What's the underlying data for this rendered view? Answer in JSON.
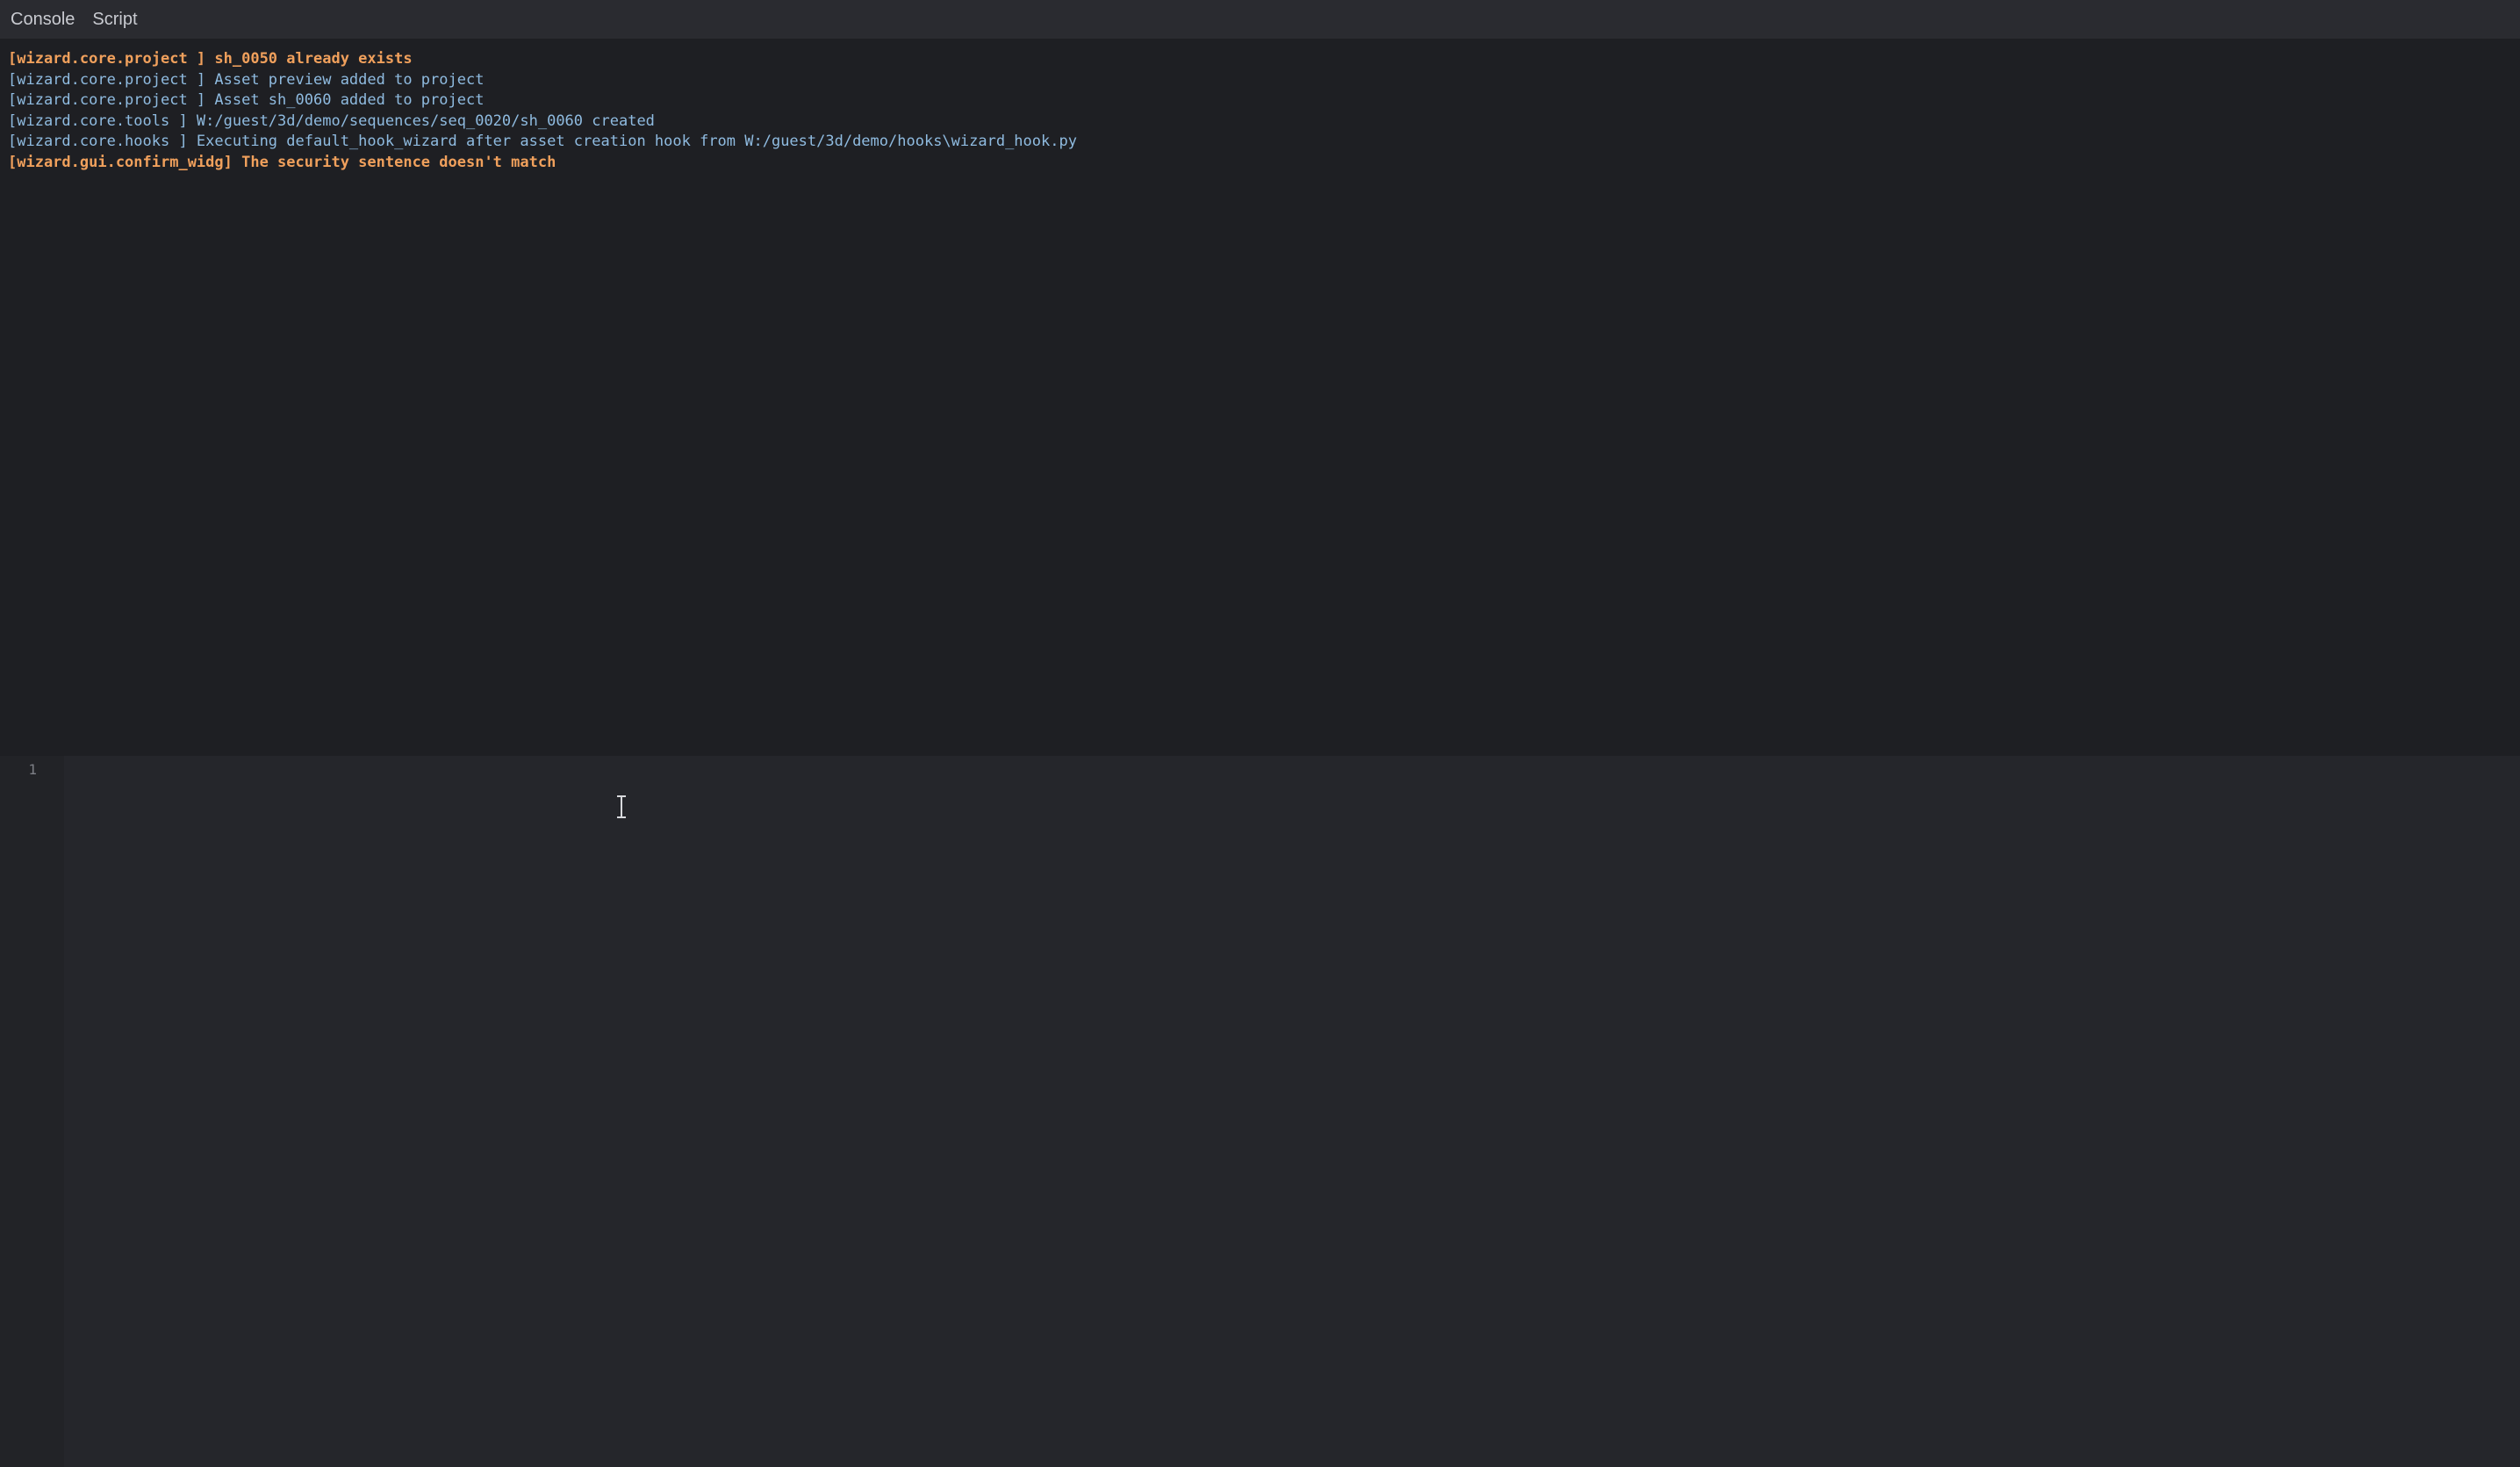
{
  "tabs": [
    {
      "label": "Console"
    },
    {
      "label": "Script"
    }
  ],
  "console": {
    "lines": [
      {
        "text": "[wizard.core.project ] sh_0050 already exists",
        "level": "warning"
      },
      {
        "text": "[wizard.core.project ] Asset preview added to project",
        "level": "info"
      },
      {
        "text": "[wizard.core.project ] Asset sh_0060 added to project",
        "level": "info"
      },
      {
        "text": "[wizard.core.tools ] W:/guest/3d/demo/sequences/seq_0020/sh_0060 created",
        "level": "info"
      },
      {
        "text": "[wizard.core.hooks ] Executing default_hook_wizard after asset creation hook from W:/guest/3d/demo/hooks\\wizard_hook.py",
        "level": "info"
      },
      {
        "text": "[wizard.gui.confirm_widg] The security sentence doesn't match",
        "level": "warning"
      }
    ]
  },
  "editor": {
    "line_numbers": [
      "1"
    ],
    "content": ""
  },
  "icons": {
    "cursor": "text-cursor-icon"
  },
  "colors": {
    "info": "#8fbbe0",
    "warning": "#f0a05c",
    "background": "#1e1f23",
    "editor_background": "#25262b"
  }
}
